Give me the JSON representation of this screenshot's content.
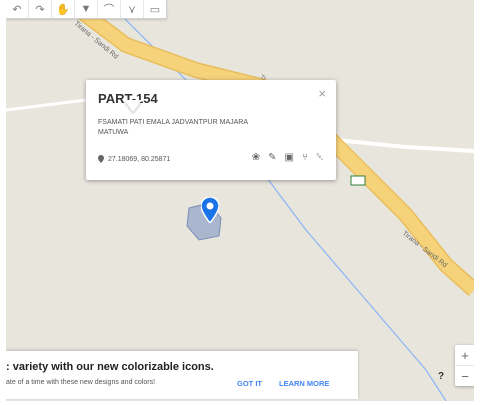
{
  "toolbar": {
    "items": [
      {
        "name": "undo-icon",
        "glyph": "↶"
      },
      {
        "name": "redo-icon",
        "glyph": "↷"
      },
      {
        "name": "hand-icon",
        "glyph": "✋"
      },
      {
        "name": "marker-icon",
        "glyph": "▼"
      },
      {
        "name": "line-icon",
        "glyph": "⌒"
      },
      {
        "name": "filter-icon",
        "glyph": "⋎"
      },
      {
        "name": "ruler-icon",
        "glyph": "▭"
      }
    ]
  },
  "roads": [
    {
      "name": "road-label-tirana-sandi-top",
      "text": "Tirana - Sandi Rd"
    },
    {
      "name": "road-label-tirana-sandi-right",
      "text": "Tirana - Sandi Rd"
    }
  ],
  "popup": {
    "title": "PART-154",
    "close_glyph": "×",
    "description": "FSAMATI PATI EMALA JADVANTPUR MAJARA MATUWA",
    "coordinates": "27.18069, 80.25871",
    "actions": [
      {
        "name": "style-icon",
        "glyph": "❀"
      },
      {
        "name": "edit-icon",
        "glyph": "✎"
      },
      {
        "name": "camera-icon",
        "glyph": "▣"
      },
      {
        "name": "directions-icon",
        "glyph": "⑂"
      },
      {
        "name": "delete-icon",
        "glyph": "␡"
      }
    ]
  },
  "banner": {
    "title": ": variety with our new colorizable icons.",
    "subtitle": "ate of a time with these new designs and colors!",
    "got_it": "GOT IT",
    "learn_more": "LEARN MORE"
  },
  "zoom": {
    "in": "+",
    "out": "−"
  },
  "help": "?",
  "colors": {
    "land": "#e8e5dd",
    "major_road": "#f6d27a",
    "minor_road": "#ffffff",
    "river": "#8ab4f8",
    "pin": "#1a73e8",
    "accent": "#4285f4"
  }
}
